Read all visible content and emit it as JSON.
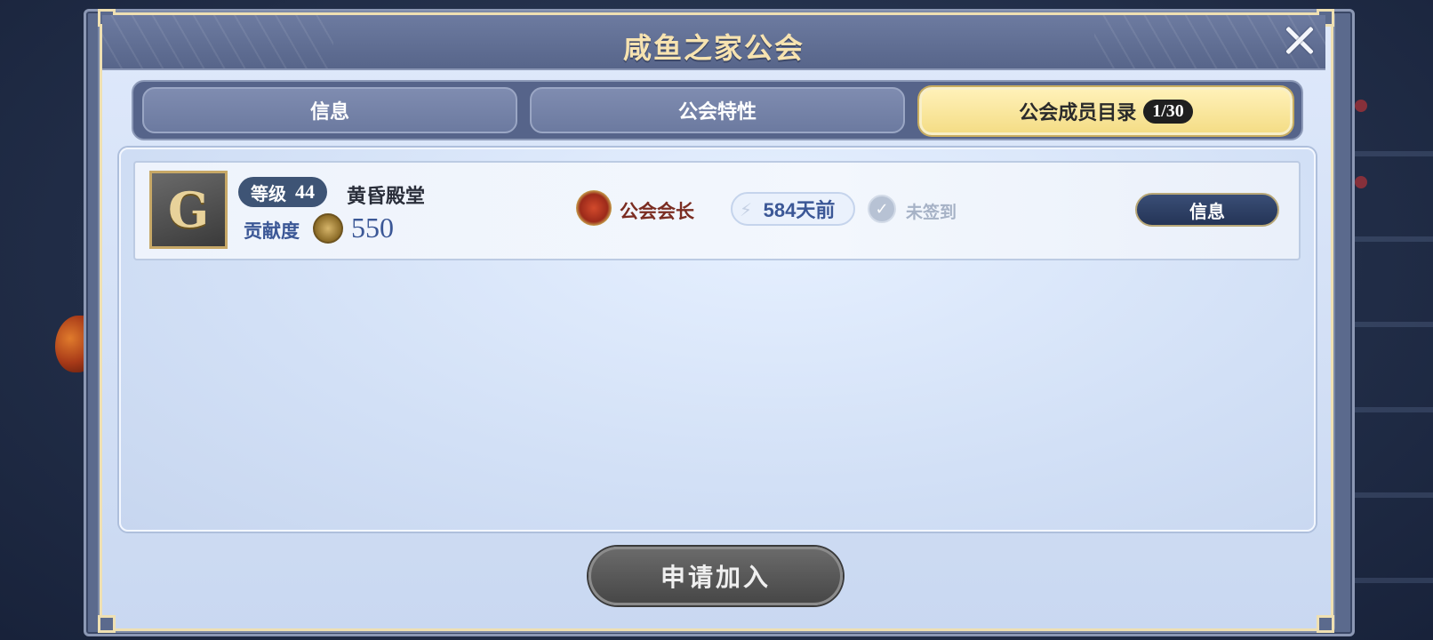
{
  "window": {
    "title": "咸鱼之家公会"
  },
  "tabs": [
    {
      "label": "信息",
      "active": false
    },
    {
      "label": "公会特性",
      "active": false
    },
    {
      "label": "公会成员目录",
      "active": true,
      "badge": "1/30"
    }
  ],
  "members": [
    {
      "avatar_glyph": "G",
      "level_label": "等级",
      "level": "44",
      "name": "黄昏殿堂",
      "contribution_label": "贡献度",
      "contribution": "550",
      "rank": "公会会长",
      "last_seen": "584天前",
      "signin_status": "未签到",
      "info_button": "信息"
    }
  ],
  "actions": {
    "apply_label": "申请加入"
  },
  "colors": {
    "accent_gold": "#f4dd86",
    "title_gold": "#f7e3b0",
    "contribution_blue": "#3b5796",
    "rank_red": "#7b2d22"
  },
  "icons": {
    "close": "close-icon",
    "coin": "contribution-coin-icon",
    "rank": "guild-leader-medal-icon",
    "lastseen": "lightning-icon",
    "signin": "check-icon"
  }
}
